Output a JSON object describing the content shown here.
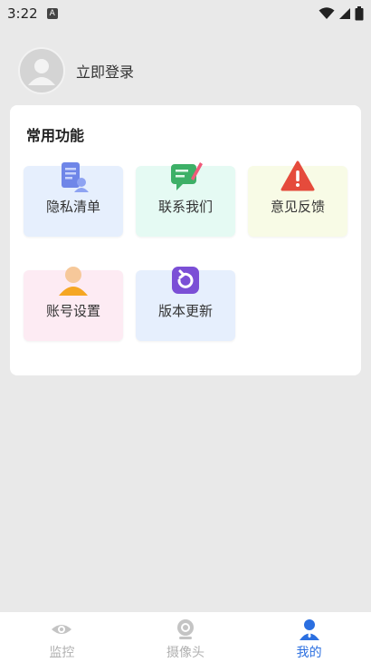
{
  "status_bar": {
    "time": "3:22",
    "notif_letter": "A"
  },
  "profile": {
    "login_label": "立即登录"
  },
  "functions": {
    "title": "常用功能",
    "items": [
      {
        "label": "隐私清单",
        "icon": "privacy-list-icon",
        "bg": "#e6effd"
      },
      {
        "label": "联系我们",
        "icon": "contact-icon",
        "bg": "#e5faf3"
      },
      {
        "label": "意见反馈",
        "icon": "warning-icon",
        "bg": "#f8fbe6"
      },
      {
        "label": "账号设置",
        "icon": "account-icon",
        "bg": "#fdebf3"
      },
      {
        "label": "版本更新",
        "icon": "update-icon",
        "bg": "#e6effd"
      }
    ]
  },
  "tabbar": {
    "tabs": [
      {
        "label": "监控",
        "icon": "eye-icon",
        "active": false
      },
      {
        "label": "摄像头",
        "icon": "camera-icon",
        "active": false
      },
      {
        "label": "我的",
        "icon": "person-icon",
        "active": true
      }
    ],
    "active_color": "#2b6fe0",
    "inactive_color": "#b0b0b0"
  }
}
